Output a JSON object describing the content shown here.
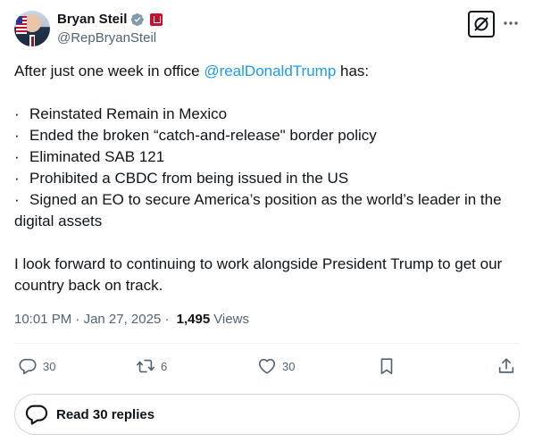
{
  "author": {
    "name": "Bryan Steil",
    "handle": "@RepBryanSteil",
    "verified_color": "#829aab",
    "affiliation_badge_color": "#c8102e"
  },
  "header": {
    "grok_icon": "grok-icon",
    "more_icon": "more-dots-icon"
  },
  "post": {
    "intro_before": "After just one week in office ",
    "mention": "@realDonaldTrump",
    "intro_after": " has:",
    "bullet_char": "·",
    "bullets": [
      "Reinstated Remain in Mexico",
      "Ended the broken “catch-and-release\" border policy",
      "Eliminated SAB 121",
      "Prohibited a CBDC from being issued in the US",
      "Signed an EO to secure America’s position as the world’s leader in the"
    ],
    "bullet_continuation": "digital assets",
    "closing": "I look forward to continuing to work alongside President Trump to get our country back on track.",
    "mention_color": "#1d9bf0"
  },
  "meta": {
    "time": "10:01 PM",
    "separator1": " · ",
    "date": "Jan 27, 2025",
    "separator2": " · ",
    "views_count": "1,495",
    "views_label": "Views"
  },
  "actions": {
    "reply_count": "30",
    "repost_count": "6",
    "like_count": "30"
  },
  "replies": {
    "label": "Read 30 replies"
  }
}
